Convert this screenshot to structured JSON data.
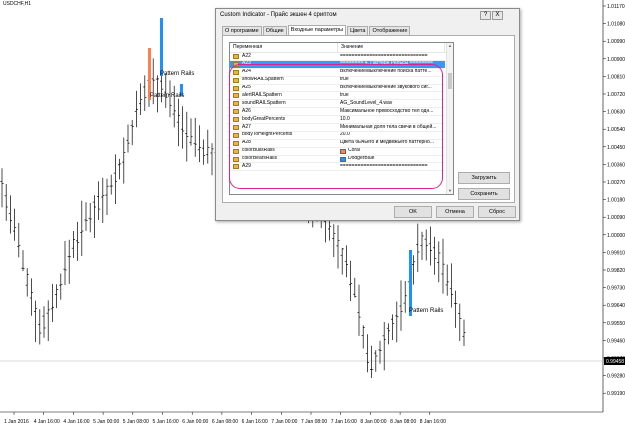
{
  "chart": {
    "symbol": "USDCHF,H1",
    "current_price": "0.99458",
    "price_ticks": [
      "1.01170",
      "1.01080",
      "1.00990",
      "1.00900",
      "1.00810",
      "1.00720",
      "1.00630",
      "1.00540",
      "1.00450",
      "1.00360",
      "1.00270",
      "1.00180",
      "1.00090",
      "1.00000",
      "0.99910",
      "0.99820",
      "0.99730",
      "0.99640",
      "0.99550",
      "0.99460",
      "0.99370",
      "0.99280",
      "0.99190"
    ],
    "time_ticks": [
      "1 Jan 2016",
      "4 Jan 16:00",
      "4 Jan 16:00",
      "5 Jan 00:00",
      "5 Jan 08:00",
      "5 Jan 16:00",
      "6 Jan 00:00",
      "6 Jan 08:00",
      "6 Jan 16:00",
      "7 Jan 00:00",
      "7 Jan 08:00",
      "7 Jan 16:00",
      "8 Jan 00:00",
      "8 Jan 08:00",
      "8 Jan 16:00"
    ],
    "annotations": [
      "Pattern Rails",
      "Pattern Rails",
      "Pattern Rails"
    ],
    "colors": {
      "bull": "#ff7f50",
      "bear": "#1e90ff",
      "bars": "#000000"
    }
  },
  "dialog": {
    "title": "Custom Indicator - Прайс экшен 4 сриптом",
    "help_button": "?",
    "close_button": "X",
    "tabs": [
      "О программе",
      "Общие",
      "Входные параметры",
      "Цвета",
      "Отображение"
    ],
    "active_tab": "Входные параметры",
    "columns": {
      "variable": "Переменная",
      "value": "Значение"
    },
    "rows": [
      {
        "var": "A22",
        "val": "=============================="
      },
      {
        "var": "A23",
        "val": "======== 4. Паттерн Рельсы ========"
      },
      {
        "var": "A24",
        "val": "Включение/выключение поиска патте..."
      },
      {
        "var": "showRAILSpattern",
        "val": "true"
      },
      {
        "var": "A25",
        "val": "Включение/выключение звукового сиг..."
      },
      {
        "var": "alertRAILSpattern",
        "val": "true"
      },
      {
        "var": "soundRAILSpattern",
        "val": "AG_SoundLevel_4.wav"
      },
      {
        "var": "A26",
        "val": "Максимальное превосходство тел одн..."
      },
      {
        "var": "bodyGreatPercents",
        "val": "10.0"
      },
      {
        "var": "A27",
        "val": "Минимальная доля тела свечи в общей..."
      },
      {
        "var": "bodyToHeightPercents",
        "val": "20.0"
      },
      {
        "var": "A28",
        "val": "Цвета бычьего и медвежьего паттерно..."
      },
      {
        "var": "colorBullsRails",
        "val": "Coral",
        "color": "#ff7f50"
      },
      {
        "var": "colorBearsRails",
        "val": "DodgerBlue",
        "color": "#1e90ff"
      },
      {
        "var": "A29",
        "val": "=============================="
      }
    ],
    "selected_row": 1,
    "buttons": {
      "load": "Загрузить",
      "save": "Сохранить",
      "ok": "OK",
      "cancel": "Отмена",
      "reset": "Сброс"
    }
  }
}
